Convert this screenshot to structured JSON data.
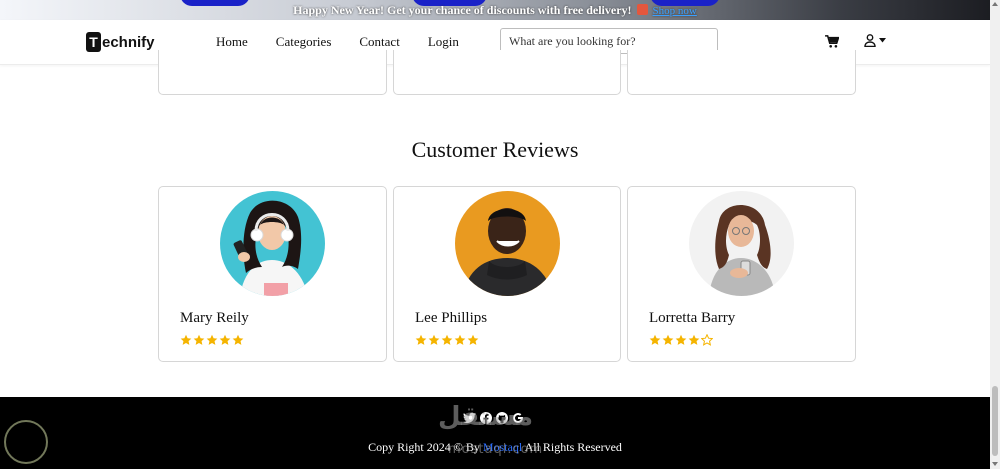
{
  "announcement": {
    "text": "Happy New Year! Get your chance of discounts with free delivery!",
    "link": "Shop now"
  },
  "navbar": {
    "logo_initial": "T",
    "logo_rest": "echnify",
    "links": [
      "Home",
      "Categories",
      "Contact",
      "Login"
    ],
    "search_placeholder": "What are you looking for?"
  },
  "reviews": {
    "title": "Customer Reviews",
    "items": [
      {
        "name": "Mary Reily",
        "rating": 5
      },
      {
        "name": "Lee Phillips",
        "rating": 5
      },
      {
        "name": "Lorretta Barry",
        "rating": 4
      }
    ]
  },
  "footer": {
    "copyright_prefix": "Copy Right 2024 © By",
    "author": "Mostaql",
    "copyright_suffix": "All Rights Reserved",
    "socials": [
      "twitter-icon",
      "facebook-icon",
      "github-icon",
      "google-icon"
    ]
  },
  "colors": {
    "star": "#f5b400",
    "footer_bg": "#000000",
    "accent": "#1a22c8"
  },
  "watermark": {
    "arabic": "مستقل",
    "latin": "mostaql.com"
  }
}
